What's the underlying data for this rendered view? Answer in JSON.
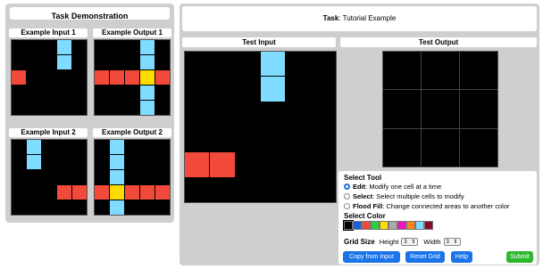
{
  "colors": {
    "black": "#000000",
    "blue": "#1e5ed9",
    "red": "#f24a3a",
    "green": "#2ecc40",
    "yellow": "#ffdc00",
    "gray": "#aaaaaa",
    "magenta": "#f012be",
    "orange": "#ff851b",
    "cyan": "#7fdbff",
    "maroon": "#870c25",
    "panel": "#cfcfcf",
    "button": "#1a73e8",
    "submit": "#2eb82e"
  },
  "demo": {
    "title": "Task Demonstration",
    "pairs": [
      {
        "input_label": "Example Input 1",
        "output_label": "Example Output 1",
        "input": [
          [
            0,
            0,
            0,
            8,
            0
          ],
          [
            0,
            0,
            0,
            8,
            0
          ],
          [
            2,
            0,
            0,
            0,
            0
          ],
          [
            0,
            0,
            0,
            0,
            0
          ],
          [
            0,
            0,
            0,
            0,
            0
          ]
        ],
        "output": [
          [
            0,
            0,
            0,
            8,
            0
          ],
          [
            0,
            0,
            0,
            8,
            0
          ],
          [
            2,
            2,
            2,
            4,
            2
          ],
          [
            0,
            0,
            0,
            8,
            0
          ],
          [
            0,
            0,
            0,
            8,
            0
          ]
        ]
      },
      {
        "input_label": "Example Input 2",
        "output_label": "Example Output 2",
        "input": [
          [
            0,
            8,
            0,
            0,
            0
          ],
          [
            0,
            8,
            0,
            0,
            0
          ],
          [
            0,
            0,
            0,
            0,
            0
          ],
          [
            0,
            0,
            0,
            2,
            2
          ],
          [
            0,
            0,
            0,
            0,
            0
          ]
        ],
        "output": [
          [
            0,
            8,
            0,
            0,
            0
          ],
          [
            0,
            8,
            0,
            0,
            0
          ],
          [
            0,
            8,
            0,
            0,
            0
          ],
          [
            2,
            4,
            2,
            2,
            2
          ],
          [
            0,
            8,
            0,
            0,
            0
          ]
        ]
      }
    ]
  },
  "task": {
    "title_prefix": "Task",
    "title_rest": ": Tutorial Example",
    "test_input_label": "Test Input",
    "test_output_label": "Test Output",
    "test_input": [
      [
        0,
        0,
        0,
        8,
        0,
        0
      ],
      [
        0,
        0,
        0,
        8,
        0,
        0
      ],
      [
        0,
        0,
        0,
        0,
        0,
        0
      ],
      [
        0,
        0,
        0,
        0,
        0,
        0
      ],
      [
        2,
        2,
        0,
        0,
        0,
        0
      ],
      [
        0,
        0,
        0,
        0,
        0,
        0
      ]
    ],
    "test_output": [
      [
        0,
        0,
        0
      ],
      [
        0,
        0,
        0
      ],
      [
        0,
        0,
        0
      ]
    ]
  },
  "tools": {
    "heading": "Select Tool",
    "options": [
      {
        "name": "Edit",
        "desc": ": Modify one cell at a time",
        "selected": true
      },
      {
        "name": "Select",
        "desc": ": Select multiple cells to modify",
        "selected": false
      },
      {
        "name": "Flood Fill",
        "desc": ": Change connected areas to another color",
        "selected": false
      }
    ],
    "color_heading": "Select Color",
    "palette": [
      0,
      1,
      2,
      3,
      4,
      5,
      6,
      7,
      8,
      9
    ],
    "selected_color": 0
  },
  "grid_size": {
    "label": "Grid Size",
    "height_label": "Height",
    "height_value": "3",
    "width_label": "Width",
    "width_value": "3"
  },
  "buttons": {
    "copy": "Copy from Input",
    "reset": "Reset Grid",
    "help": "Help",
    "submit": "Submit"
  }
}
